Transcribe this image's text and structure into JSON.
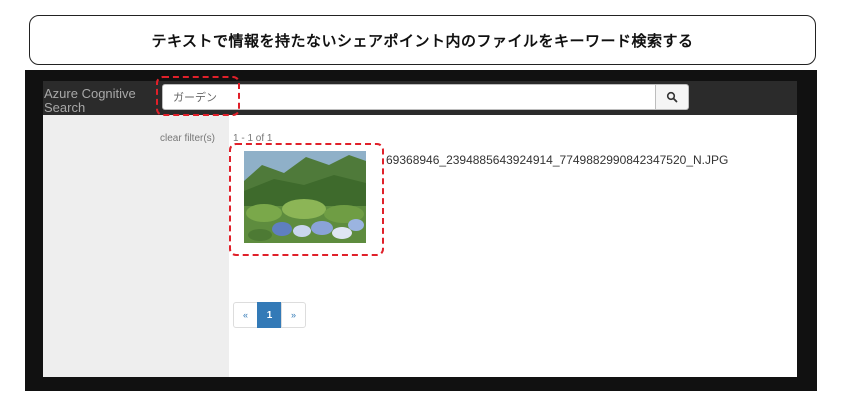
{
  "caption": "テキストで情報を持たないシェアポイント内のファイルをキーワード検索する",
  "app": {
    "brand": "Azure Cognitive Search",
    "search": {
      "value": "ガーデン",
      "placeholder": ""
    },
    "search_icon": "search-icon",
    "sidebar": {
      "clear_filters": "clear filter(s)"
    },
    "results": {
      "count_text": "1 - 1 of 1",
      "items": [
        {
          "filename": "69368946_2394885643924914_7749882990842347520_N.JPG",
          "thumbnail": "garden-photo"
        }
      ]
    },
    "pagination": {
      "prev": "«",
      "pages": [
        "1"
      ],
      "next": "»",
      "current": "1"
    }
  },
  "colors": {
    "navbar": "#2b2b2b",
    "frame": "#111111",
    "sidebar": "#eeeeee",
    "accent": "#337ab7",
    "highlight": "#e0202a"
  }
}
